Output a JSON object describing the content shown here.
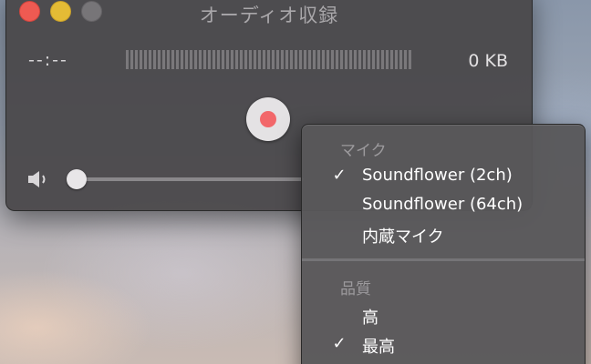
{
  "window": {
    "title": "オーディオ収録",
    "time": "--:--",
    "file_size": "0 KB",
    "volume": 0.0
  },
  "menu": {
    "mic_header": "マイク",
    "mic_items": [
      {
        "label": "Soundflower (2ch)",
        "checked": true
      },
      {
        "label": "Soundflower (64ch)",
        "checked": false
      },
      {
        "label": "内蔵マイク",
        "checked": false
      }
    ],
    "quality_header": "品質",
    "quality_items": [
      {
        "label": "高",
        "checked": false
      },
      {
        "label": "最高",
        "checked": true
      }
    ],
    "check_glyph": "✓"
  },
  "icons": {
    "close": "close-icon",
    "minimize": "minimize-icon",
    "zoom": "zoom-icon",
    "speaker": "speaker-icon",
    "record": "record-icon"
  },
  "colors": {
    "close": "#ee5a52",
    "minimize": "#e4bb35",
    "zoom": "#777578",
    "record_dot": "#f2676a"
  }
}
